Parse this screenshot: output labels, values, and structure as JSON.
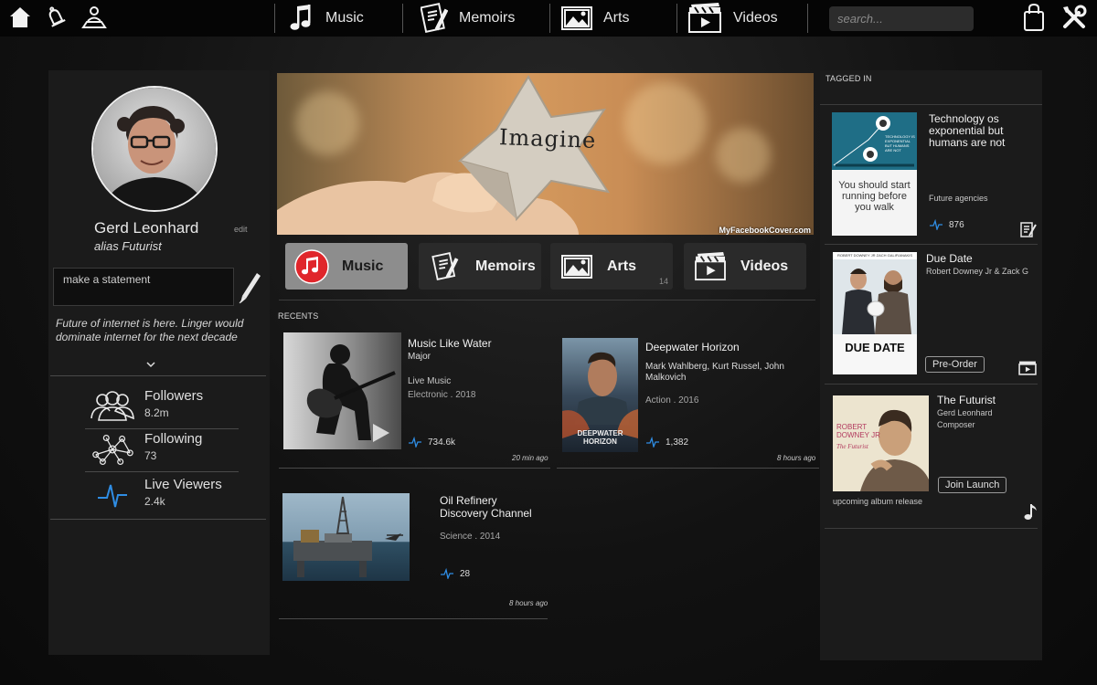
{
  "topbar": {
    "home_icon": "home-icon",
    "bell_icon": "bell-icon",
    "profile_icon": "profile-icon",
    "nav": [
      {
        "label": "Music",
        "icon": "music-note-icon"
      },
      {
        "label": "Memoirs",
        "icon": "memoir-icon"
      },
      {
        "label": "Arts",
        "icon": "picture-icon"
      },
      {
        "label": "Videos",
        "icon": "clapperboard-icon"
      }
    ],
    "search_placeholder": "search...",
    "bag_icon": "bag-icon",
    "tools_icon": "tools-icon"
  },
  "profile": {
    "name": "Gerd Leonhard",
    "edit_label": "edit",
    "alias": "alias Futurist",
    "statement_placeholder": "make a statement",
    "bio": "Future of internet is here. Linger would dominate internet for the next decade",
    "stats": [
      {
        "label": "Followers",
        "value": "8.2m",
        "icon": "followers-icon"
      },
      {
        "label": "Following",
        "value": "73",
        "icon": "network-icon"
      },
      {
        "label": "Live Viewers",
        "value": "2.4k",
        "icon": "pulse-icon"
      }
    ]
  },
  "banner": {
    "text": "Imagine",
    "credit": "MyFacebookCover.com"
  },
  "categories": [
    {
      "label": "Music",
      "active": true
    },
    {
      "label": "Memoirs",
      "active": false
    },
    {
      "label": "Arts",
      "active": false,
      "count": "14"
    },
    {
      "label": "Videos",
      "active": false
    }
  ],
  "recents": {
    "label": "RECENTS",
    "items": [
      {
        "title": "Music Like Water",
        "subtitle": "Major",
        "meta1": "Live Music",
        "meta2": "Electronic . 2018",
        "views": "734.6k",
        "time": "20 min ago"
      },
      {
        "title": "Deepwater Horizon",
        "subtitle": "Mark Wahlberg, Kurt Russel, John Malkovich",
        "meta1": "Action . 2016",
        "views": "1,382",
        "time": "8 hours ago",
        "poster_line1": "DEEPWATER",
        "poster_line2": "HORIZON"
      },
      {
        "title": "Oil Refinery Discovery Channel",
        "meta1": "Science . 2014",
        "views": "28",
        "time": "8 hours ago"
      }
    ]
  },
  "tagged": {
    "label": "TAGGED IN",
    "items": [
      {
        "title": "Technology os exponential but humans are not",
        "subtitle": "Future agencies",
        "views": "876",
        "thumb_text": "You should start running before you walk",
        "thumb_small": "TECHNOLOGY IS EXPONENTIAL BUT HUMANS ARE NOT"
      },
      {
        "title": "Due Date",
        "subtitle": "Robert Downey Jr & Zack G",
        "button": "Pre-Order",
        "poster_title": "DUE DATE",
        "poster_top": "ROBERT DOWNEY JR   ZACH GALIFIANAKIS"
      },
      {
        "title": "The Futurist",
        "subtitle": "Gerd Leonhard",
        "role": "Composer",
        "button": "Join Launch",
        "note": "upcoming album release",
        "album_text1": "ROBERT",
        "album_text2": "DOWNEY JR",
        "album_text3": "The Futurist"
      }
    ]
  },
  "colors": {
    "accent_blue": "#2f8de4",
    "music_red": "#e0262b"
  }
}
